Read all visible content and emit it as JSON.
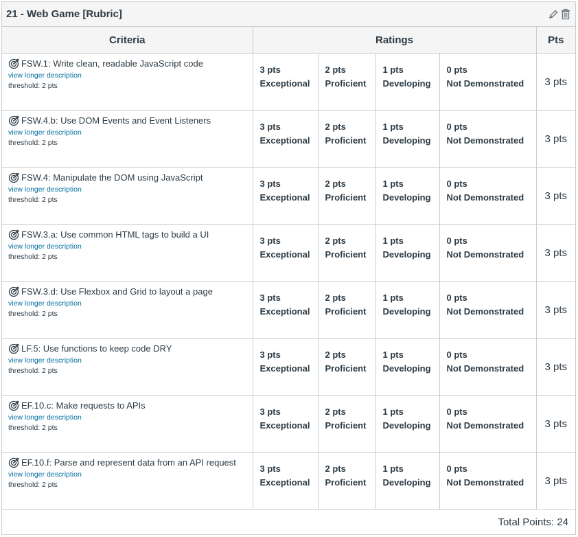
{
  "rubric": {
    "title": "21 - Web Game [Rubric]",
    "headers": {
      "criteria": "Criteria",
      "ratings": "Ratings",
      "pts": "Pts"
    },
    "criteria": [
      {
        "title": "FSW.1: Write clean, readable JavaScript code",
        "link": "view longer description",
        "threshold": "threshold: 2 pts",
        "points": "3 pts",
        "ratings": [
          {
            "pts": "3 pts",
            "label": "Exceptional"
          },
          {
            "pts": "2 pts",
            "label": "Proficient"
          },
          {
            "pts": "1 pts",
            "label": "Developing"
          },
          {
            "pts": "0 pts",
            "label": "Not Demonstrated"
          }
        ]
      },
      {
        "title": "FSW.4.b: Use DOM Events and Event Listeners",
        "link": "view longer description",
        "threshold": "threshold: 2 pts",
        "points": "3 pts",
        "ratings": [
          {
            "pts": "3 pts",
            "label": "Exceptional"
          },
          {
            "pts": "2 pts",
            "label": "Proficient"
          },
          {
            "pts": "1 pts",
            "label": "Developing"
          },
          {
            "pts": "0 pts",
            "label": "Not Demonstrated"
          }
        ]
      },
      {
        "title": "FSW.4: Manipulate the DOM using JavaScript",
        "link": "view longer description",
        "threshold": "threshold: 2 pts",
        "points": "3 pts",
        "ratings": [
          {
            "pts": "3 pts",
            "label": "Exceptional"
          },
          {
            "pts": "2 pts",
            "label": "Proficient"
          },
          {
            "pts": "1 pts",
            "label": "Developing"
          },
          {
            "pts": "0 pts",
            "label": "Not Demonstrated"
          }
        ]
      },
      {
        "title": "FSW.3.a: Use common HTML tags to build a UI",
        "link": "view longer description",
        "threshold": "threshold: 2 pts",
        "points": "3 pts",
        "ratings": [
          {
            "pts": "3 pts",
            "label": "Exceptional"
          },
          {
            "pts": "2 pts",
            "label": "Proficient"
          },
          {
            "pts": "1 pts",
            "label": "Developing"
          },
          {
            "pts": "0 pts",
            "label": "Not Demonstrated"
          }
        ]
      },
      {
        "title": "FSW.3.d: Use Flexbox and Grid to layout a page",
        "link": "view longer description",
        "threshold": "threshold: 2 pts",
        "points": "3 pts",
        "ratings": [
          {
            "pts": "3 pts",
            "label": "Exceptional"
          },
          {
            "pts": "2 pts",
            "label": "Proficient"
          },
          {
            "pts": "1 pts",
            "label": "Developing"
          },
          {
            "pts": "0 pts",
            "label": "Not Demonstrated"
          }
        ]
      },
      {
        "title": "LF.5: Use functions to keep code DRY",
        "link": "view longer description",
        "threshold": "threshold: 2 pts",
        "points": "3 pts",
        "ratings": [
          {
            "pts": "3 pts",
            "label": "Exceptional"
          },
          {
            "pts": "2 pts",
            "label": "Proficient"
          },
          {
            "pts": "1 pts",
            "label": "Developing"
          },
          {
            "pts": "0 pts",
            "label": "Not Demonstrated"
          }
        ]
      },
      {
        "title": "EF.10.c: Make requests to APIs",
        "link": "view longer description",
        "threshold": "threshold: 2 pts",
        "points": "3 pts",
        "ratings": [
          {
            "pts": "3 pts",
            "label": "Exceptional"
          },
          {
            "pts": "2 pts",
            "label": "Proficient"
          },
          {
            "pts": "1 pts",
            "label": "Developing"
          },
          {
            "pts": "0 pts",
            "label": "Not Demonstrated"
          }
        ]
      },
      {
        "title": "EF.10.f: Parse and represent data from an API request",
        "link": "view longer description",
        "threshold": "threshold: 2 pts",
        "points": "3 pts",
        "ratings": [
          {
            "pts": "3 pts",
            "label": "Exceptional"
          },
          {
            "pts": "2 pts",
            "label": "Proficient"
          },
          {
            "pts": "1 pts",
            "label": "Developing"
          },
          {
            "pts": "0 pts",
            "label": "Not Demonstrated"
          }
        ]
      }
    ],
    "total": "Total Points: 24",
    "icons": {
      "edit": "pencil-icon",
      "delete": "trash-icon",
      "outcome": "target-icon"
    },
    "colors": {
      "link": "#0770a3",
      "text": "#2d3b45",
      "border": "#c7cdd1",
      "header_bg": "#f5f5f5"
    }
  }
}
